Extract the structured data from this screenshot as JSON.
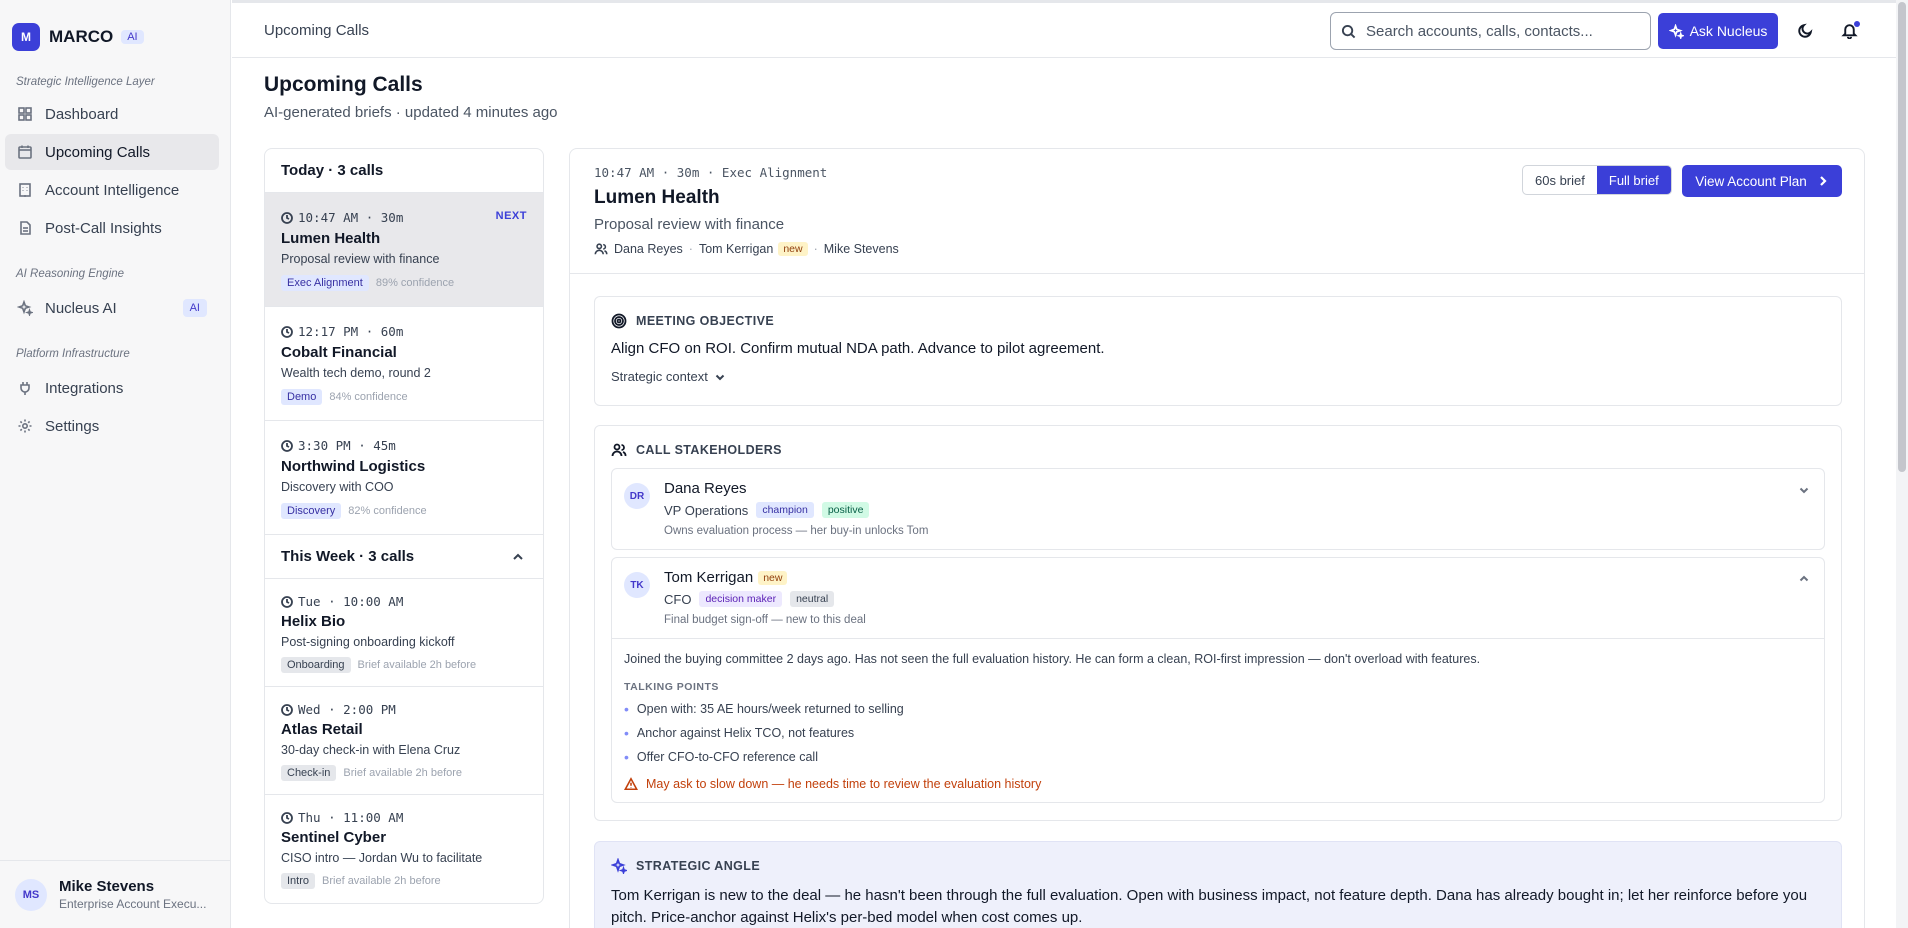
{
  "sidebar": {
    "brand": {
      "logo": "M",
      "name": "MARCO",
      "badge": "AI"
    },
    "sections": [
      {
        "label": "Strategic Intelligence Layer"
      },
      {
        "label": "AI Reasoning Engine"
      },
      {
        "label": "Platform Infrastructure"
      }
    ],
    "items": [
      {
        "label": "Dashboard",
        "icon": "grid-icon"
      },
      {
        "label": "Upcoming Calls",
        "icon": "calendar-clock-icon",
        "active": true
      },
      {
        "label": "Account Intelligence",
        "icon": "building-icon"
      },
      {
        "label": "Post-Call Insights",
        "icon": "document-icon"
      },
      {
        "label": "Nucleus AI",
        "icon": "sparkles-icon",
        "badge": "AI"
      },
      {
        "label": "Integrations",
        "icon": "plug-icon"
      },
      {
        "label": "Settings",
        "icon": "gear-icon"
      }
    ],
    "user": {
      "initials": "MS",
      "name": "Mike Stevens",
      "role": "Enterprise Account Execu..."
    }
  },
  "topbar": {
    "title": "Upcoming Calls",
    "search_placeholder": "Search accounts, calls, contacts...",
    "ask_label": "Ask Nucleus"
  },
  "page": {
    "title": "Upcoming Calls",
    "subtitle": "AI-generated briefs · updated 4 minutes ago"
  },
  "call_list": {
    "today_header": "Today · 3 calls",
    "week_header": "This Week · 3 calls",
    "today": [
      {
        "time": "10:47 AM · 30m",
        "name": "Lumen Health",
        "desc": "Proposal review with finance",
        "tag": "Exec Alignment",
        "meta": "89% confidence",
        "next": "NEXT"
      },
      {
        "time": "12:17 PM · 60m",
        "name": "Cobalt Financial",
        "desc": "Wealth tech demo, round 2",
        "tag": "Demo",
        "meta": "84% confidence"
      },
      {
        "time": "3:30 PM · 45m",
        "name": "Northwind Logistics",
        "desc": "Discovery with COO",
        "tag": "Discovery",
        "meta": "82% confidence"
      }
    ],
    "week": [
      {
        "time": "Tue · 10:00 AM",
        "name": "Helix Bio",
        "desc": "Post-signing onboarding kickoff",
        "tag": "Onboarding",
        "meta": "Brief available 2h before"
      },
      {
        "time": "Wed · 2:00 PM",
        "name": "Atlas Retail",
        "desc": "30-day check-in with Elena Cruz",
        "tag": "Check-in",
        "meta": "Brief available 2h before"
      },
      {
        "time": "Thu · 11:00 AM",
        "name": "Sentinel Cyber",
        "desc": "CISO intro — Jordan Wu to facilitate",
        "tag": "Intro",
        "meta": "Brief available 2h before"
      }
    ]
  },
  "detail": {
    "time": "10:47 AM · 30m · Exec Alignment",
    "name": "Lumen Health",
    "subtitle": "Proposal review with finance",
    "attendees": {
      "a1": "Dana Reyes",
      "a2": "Tom Kerrigan",
      "a2_tag": "new",
      "a3": "Mike Stevens"
    },
    "brief_short": "60s brief",
    "brief_full": "Full brief",
    "plan_button": "View Account Plan",
    "objective": {
      "heading": "MEETING OBJECTIVE",
      "text": "Align CFO on ROI. Confirm mutual NDA path. Advance to pilot agreement.",
      "context_toggle": "Strategic context"
    },
    "stakeholders": {
      "heading": "CALL STAKEHOLDERS",
      "people": [
        {
          "initials": "DR",
          "name": "Dana Reyes",
          "role": "VP Operations",
          "chip1": "champion",
          "chip2": "positive",
          "note": "Owns evaluation process — her buy-in unlocks Tom"
        },
        {
          "initials": "TK",
          "name": "Tom Kerrigan",
          "name_tag": "new",
          "role": "CFO",
          "chip1": "decision maker",
          "chip2": "neutral",
          "note": "Final budget sign-off — new to this deal",
          "summary": "Joined the buying committee 2 days ago. Has not seen the full evaluation history. He can form a clean, ROI-first impression — don't overload with features.",
          "talking_label": "TALKING POINTS",
          "points": [
            "Open with: 35 AE hours/week returned to selling",
            "Anchor against Helix TCO, not features",
            "Offer CFO-to-CFO reference call"
          ],
          "warning": "May ask to slow down — he needs time to review the evaluation history"
        }
      ]
    },
    "angle": {
      "heading": "STRATEGIC ANGLE",
      "text": "Tom Kerrigan is new to the deal — he hasn't been through the full evaluation. Open with business impact, not feature depth. Dana has already bought in; let her reinforce before you pitch. Price-anchor against Helix's per-bed model when cost comes up."
    }
  },
  "colors": {
    "accent": "#3b3fd8",
    "accent_soft": "#e0e7ff",
    "warning": "#c2410c"
  }
}
